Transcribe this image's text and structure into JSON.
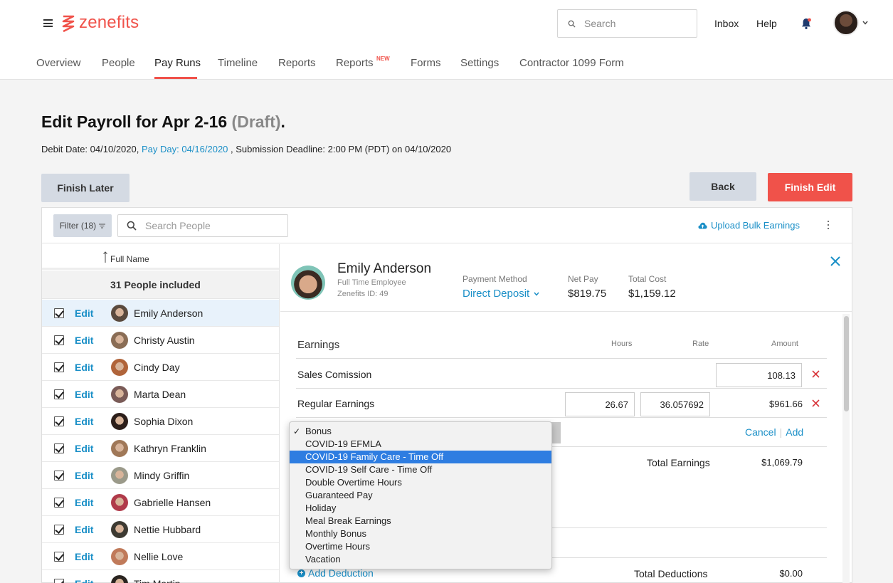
{
  "app": {
    "brand": "zenefits",
    "brand_color": "#f0524a",
    "link_color": "#1a8fc7"
  },
  "header": {
    "search_placeholder": "Search",
    "inbox": "Inbox",
    "help": "Help"
  },
  "nav": {
    "items": [
      {
        "label": "Overview"
      },
      {
        "label": "People"
      },
      {
        "label": "Pay Runs",
        "active": true
      },
      {
        "label": "Timeline"
      },
      {
        "label": "Reports"
      },
      {
        "label": "Reports",
        "badge": "NEW"
      },
      {
        "label": "Forms"
      },
      {
        "label": "Settings"
      },
      {
        "label": "Contractor 1099 Form"
      }
    ]
  },
  "page": {
    "title": "Edit Payroll for Apr 2-16",
    "title_status": "(Draft)",
    "title_end": ".",
    "debit_label": "Debit Date:",
    "debit_value": "04/10/2020,",
    "payday": "Pay Day: 04/16/2020",
    "submission_label": ", Submission Deadline:",
    "submission_value": "2:00 PM (PDT) on 04/10/2020"
  },
  "buttons": {
    "finish_later": "Finish Later",
    "back": "Back",
    "finish_edit": "Finish Edit"
  },
  "toolbar": {
    "filter": "Filter (18)",
    "search_placeholder": "Search People",
    "upload": "Upload Bulk Earnings"
  },
  "people_list": {
    "column_header": "Full Name",
    "included": "31 People included",
    "edit_label": "Edit",
    "people": [
      {
        "name": "Emily Anderson",
        "selected": true,
        "avatar_color": "#5a4a3e"
      },
      {
        "name": "Christy Austin",
        "avatar_color": "#8a6d55"
      },
      {
        "name": "Cindy Day",
        "avatar_color": "#b0643a"
      },
      {
        "name": "Marta Dean",
        "avatar_color": "#7a5b57"
      },
      {
        "name": "Sophia Dixon",
        "avatar_color": "#2c1e1a"
      },
      {
        "name": "Kathryn Franklin",
        "avatar_color": "#a07858"
      },
      {
        "name": "Mindy Griffin",
        "avatar_color": "#9b9a8a"
      },
      {
        "name": "Gabrielle Hansen",
        "avatar_color": "#b03a4a"
      },
      {
        "name": "Nettie Hubbard",
        "avatar_color": "#3d3a32"
      },
      {
        "name": "Nellie Love",
        "avatar_color": "#c07a5a"
      },
      {
        "name": "Tim Martin",
        "avatar_color": "#2a2420"
      }
    ]
  },
  "employee": {
    "name": "Emily Anderson",
    "type": "Full Time Employee",
    "id": "Zenefits ID: 49",
    "payment_method_label": "Payment Method",
    "payment_method": "Direct Deposit",
    "net_pay_label": "Net Pay",
    "net_pay": "$819.75",
    "total_cost_label": "Total Cost",
    "total_cost": "$1,159.12"
  },
  "earnings": {
    "title": "Earnings",
    "col_hours": "Hours",
    "col_rate": "Rate",
    "col_amount": "Amount",
    "rows": [
      {
        "label": "Sales Comission",
        "amount": "108.13"
      },
      {
        "label": "Regular Earnings",
        "hours": "26.67",
        "rate": "36.057692",
        "amount": "$961.66"
      }
    ],
    "cancel": "Cancel",
    "add": "Add",
    "total_label": "Total Earnings",
    "total_value": "$1,069.79"
  },
  "deductions": {
    "add_label": "Add Deduction",
    "total_label": "Total Deductions",
    "total_value": "$0.00"
  },
  "dropdown": {
    "highlight_color": "#2e7de1",
    "items": [
      {
        "label": "Bonus",
        "checked": true
      },
      {
        "label": "COVID-19 EFMLA"
      },
      {
        "label": "COVID-19 Family Care - Time Off",
        "highlighted": true
      },
      {
        "label": "COVID-19 Self Care - Time Off"
      },
      {
        "label": "Double Overtime Hours"
      },
      {
        "label": "Guaranteed Pay"
      },
      {
        "label": "Holiday"
      },
      {
        "label": "Meal Break Earnings"
      },
      {
        "label": "Monthly Bonus"
      },
      {
        "label": "Overtime Hours"
      },
      {
        "label": "Vacation"
      }
    ]
  }
}
